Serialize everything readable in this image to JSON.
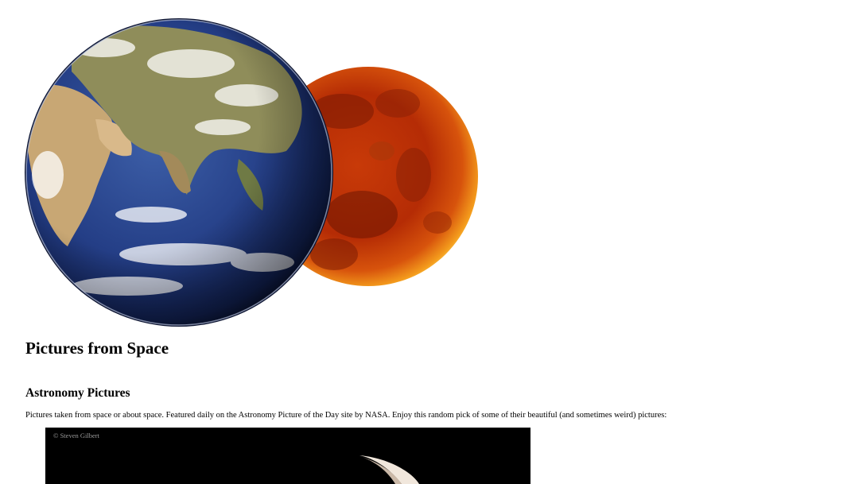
{
  "page": {
    "title": "Pictures from Space",
    "subtitle": "Astronomy Pictures",
    "intro": "Pictures taken from space or about space. Featured daily on the Astronomy Picture of the Day site by NASA. Enjoy this random pick of some of their beautiful (and sometimes weird) pictures:"
  },
  "photo": {
    "credit": "© Steven Gilbert"
  },
  "colors": {
    "background": "#ffffff",
    "text": "#000000",
    "photo_background": "#000000",
    "credit_text": "#9a9a9a"
  }
}
